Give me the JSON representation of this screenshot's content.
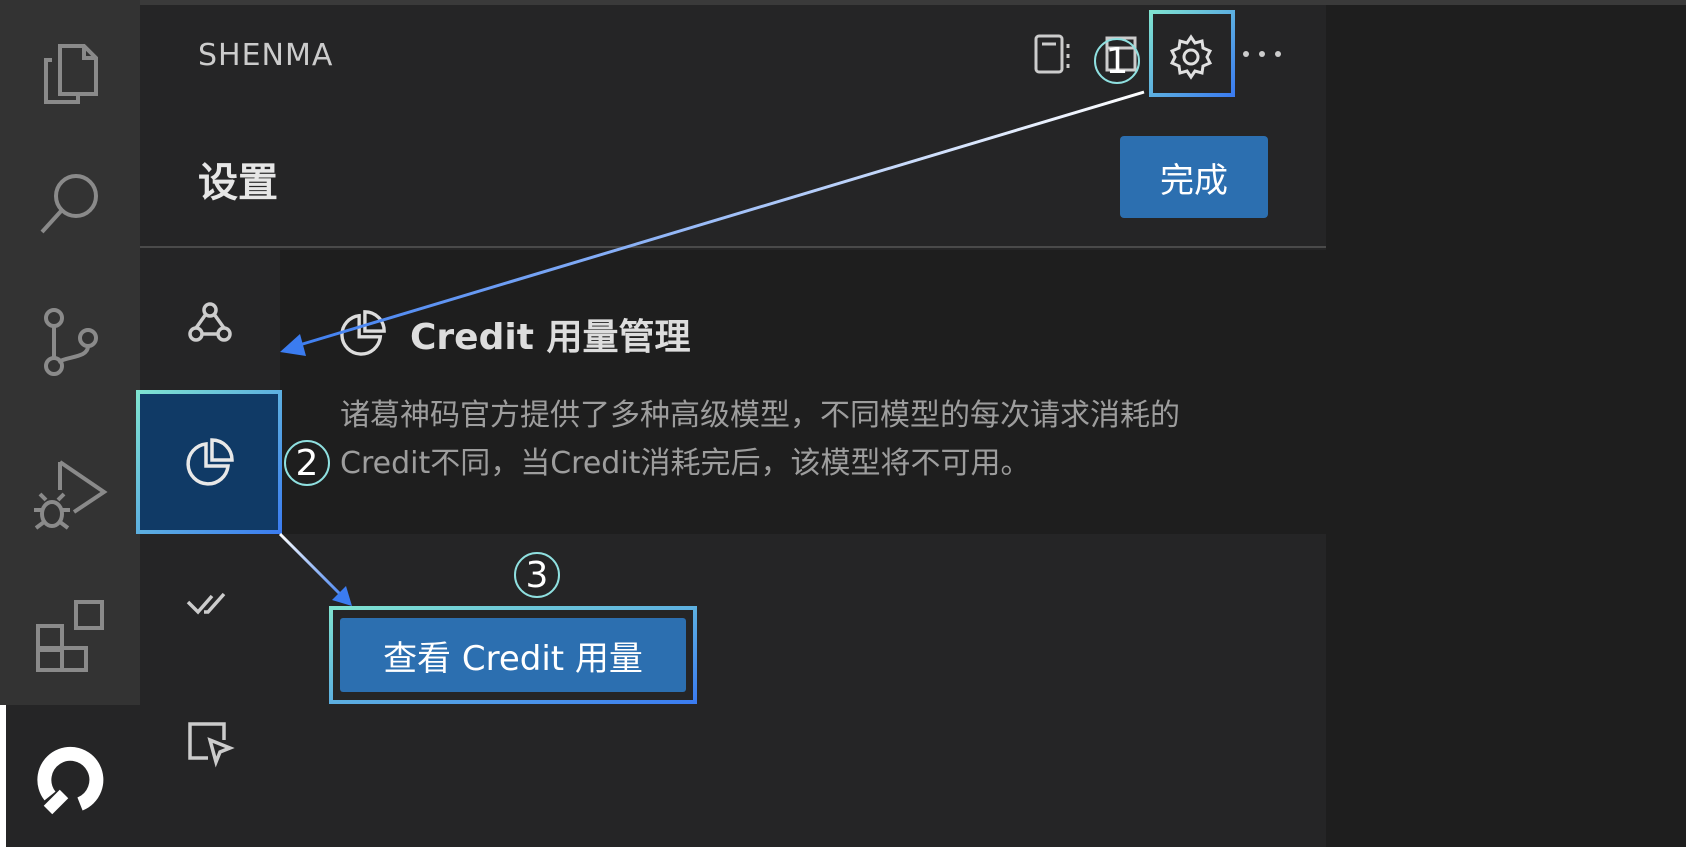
{
  "app": {
    "title": "SHENMA"
  },
  "header": {
    "settings_title": "设置",
    "done_label": "完成"
  },
  "activity_bar": {
    "items": [
      {
        "icon": "files-icon"
      },
      {
        "icon": "search-icon"
      },
      {
        "icon": "source-control-icon"
      },
      {
        "icon": "run-debug-icon"
      },
      {
        "icon": "extensions-icon"
      },
      {
        "icon": "shenma-logo-icon",
        "active": true
      }
    ]
  },
  "header_actions": [
    {
      "icon": "notebook-icon"
    },
    {
      "icon": "panel-icon"
    },
    {
      "icon": "gear-icon"
    },
    {
      "icon": "more-icon"
    }
  ],
  "settings_nav": {
    "items": [
      {
        "icon": "webhook-icon"
      },
      {
        "icon": "pie-chart-icon",
        "selected": true
      },
      {
        "icon": "check-all-icon"
      },
      {
        "icon": "pointer-select-icon"
      }
    ]
  },
  "credit": {
    "title": "Credit 用量管理",
    "description": "诸葛神码官方提供了多种高级模型，不同模型的每次请求消耗的Credit不同，当Credit消耗完后，该模型将不可用。",
    "view_button": "查看 Credit 用量"
  },
  "annotations": {
    "step1": "1",
    "step2": "2",
    "step3": "3",
    "highlight_colors": [
      "#7fe3d0",
      "#3b7cf0"
    ],
    "arrow_color": "#4f8cf0"
  }
}
